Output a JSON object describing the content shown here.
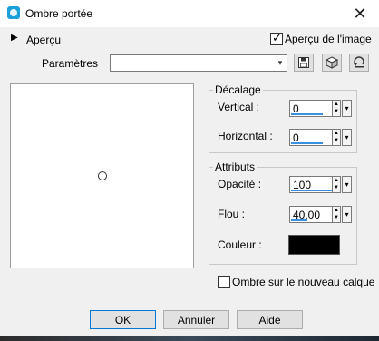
{
  "window": {
    "title": "Ombre portée",
    "close_glyph": "✕"
  },
  "header": {
    "apercu_toggle_glyph": "▶",
    "apercu_label": "Aperçu",
    "apercu_image_label": "Aperçu de l'image",
    "apercu_image_checked": true
  },
  "parametres": {
    "label": "Paramètres",
    "value": "",
    "dropdown_glyph": "▾"
  },
  "toolbar": {
    "save_icon": "save-icon",
    "cube_icon": "cube-icon",
    "reset_icon": "reset-icon"
  },
  "decalage": {
    "title": "Décalage",
    "vertical_label": "Vertical :",
    "vertical_value": "0",
    "horizontal_label": "Horizontal :",
    "horizontal_value": "0"
  },
  "attributs": {
    "title": "Attributs",
    "opacite_label": "Opacité :",
    "opacite_value": "100",
    "opacite_level": 1.0,
    "flou_label": "Flou :",
    "flou_value": "40,00",
    "flou_level": 0.4,
    "couleur_label": "Couleur :",
    "couleur_color": "#000000"
  },
  "nouveau_calque": {
    "label": "Ombre sur le nouveau calque",
    "checked": false
  },
  "buttons": {
    "ok": "OK",
    "annuler": "Annuler",
    "aide": "Aide"
  },
  "colors": {
    "accent": "#3b8fe0",
    "default_button_border": "#0078d7",
    "title_icon": "#1ca0d8"
  }
}
